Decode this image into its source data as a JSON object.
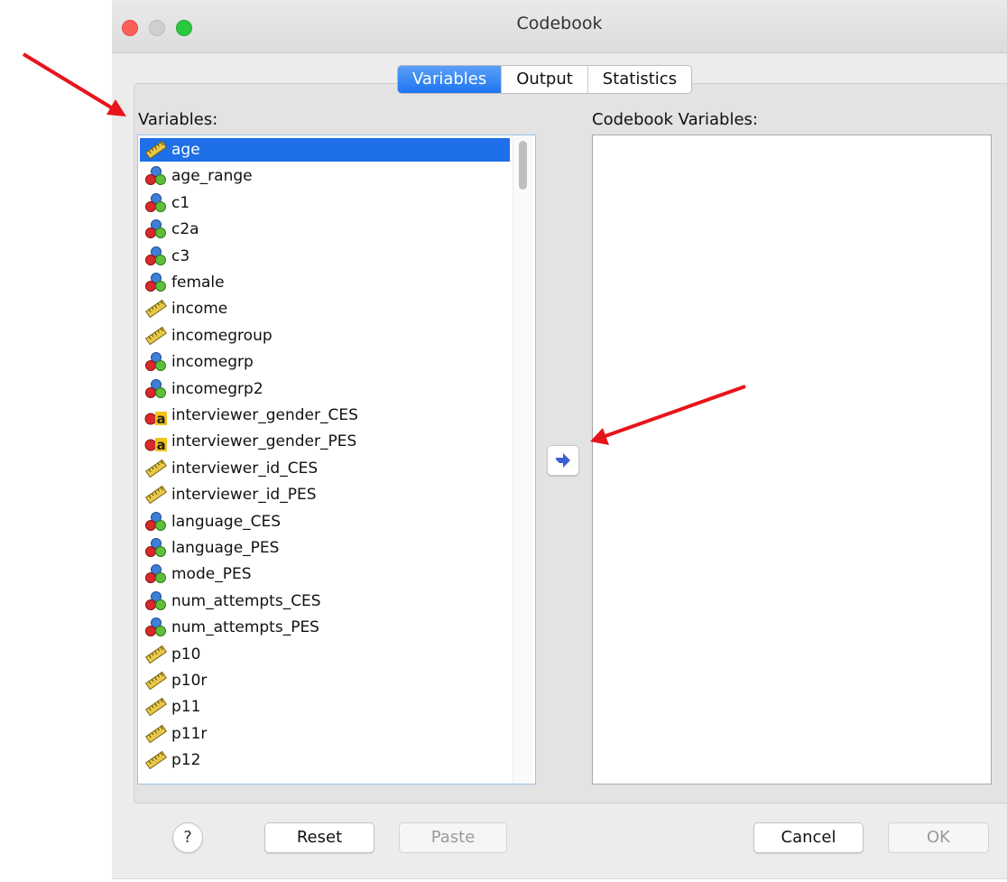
{
  "window": {
    "title": "Codebook"
  },
  "tabs": [
    {
      "label": "Variables",
      "active": true
    },
    {
      "label": "Output",
      "active": false
    },
    {
      "label": "Statistics",
      "active": false
    }
  ],
  "variables_label": "Variables:",
  "codebook_label": "Codebook Variables:",
  "variables": [
    {
      "name": "age",
      "type": "scale",
      "selected": true
    },
    {
      "name": "age_range",
      "type": "nominal"
    },
    {
      "name": "c1",
      "type": "nominal"
    },
    {
      "name": "c2a",
      "type": "nominal"
    },
    {
      "name": "c3",
      "type": "nominal"
    },
    {
      "name": "female",
      "type": "nominal"
    },
    {
      "name": "income",
      "type": "scale"
    },
    {
      "name": "incomegroup",
      "type": "scale"
    },
    {
      "name": "incomegrp",
      "type": "nominal"
    },
    {
      "name": "incomegrp2",
      "type": "nominal"
    },
    {
      "name": "interviewer_gender_CES",
      "type": "string"
    },
    {
      "name": "interviewer_gender_PES",
      "type": "string"
    },
    {
      "name": "interviewer_id_CES",
      "type": "scale"
    },
    {
      "name": "interviewer_id_PES",
      "type": "scale"
    },
    {
      "name": "language_CES",
      "type": "nominal"
    },
    {
      "name": "language_PES",
      "type": "nominal"
    },
    {
      "name": "mode_PES",
      "type": "nominal"
    },
    {
      "name": "num_attempts_CES",
      "type": "nominal"
    },
    {
      "name": "num_attempts_PES",
      "type": "nominal"
    },
    {
      "name": "p10",
      "type": "scale"
    },
    {
      "name": "p10r",
      "type": "scale"
    },
    {
      "name": "p11",
      "type": "scale"
    },
    {
      "name": "p11r",
      "type": "scale"
    },
    {
      "name": "p12",
      "type": "scale"
    }
  ],
  "codebook_variables": [],
  "buttons": {
    "help": "?",
    "reset": "Reset",
    "paste": "Paste",
    "cancel": "Cancel",
    "ok": "OK"
  },
  "colors": {
    "selection": "#1e6fe8",
    "tab_active": "#1e74ef",
    "annotation_arrow": "#e8141b"
  }
}
